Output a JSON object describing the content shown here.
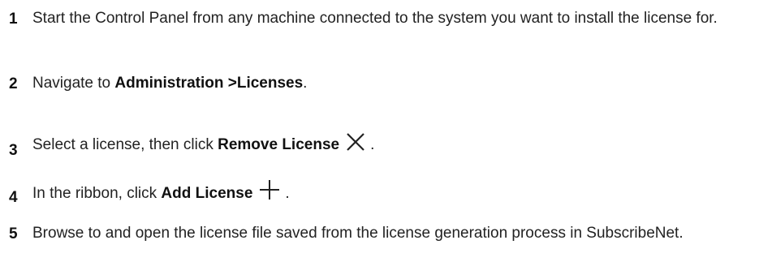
{
  "steps": [
    {
      "number": "1",
      "text": "Start the Control Panel from any machine connected to the system you want to install the license for."
    },
    {
      "number": "2",
      "prefix": "Navigate to ",
      "bold": "Administration >Licenses",
      "suffix": "."
    },
    {
      "number": "3",
      "prefix": "Select a license, then click ",
      "bold": "Remove License",
      "icon": "close-icon",
      "suffix": "."
    },
    {
      "number": "4",
      "prefix": "In the ribbon, click ",
      "bold": "Add License",
      "icon": "plus-icon",
      "suffix": "."
    },
    {
      "number": "5",
      "text": "Browse to and open the license file saved from the license generation process in SubscribeNet."
    }
  ]
}
